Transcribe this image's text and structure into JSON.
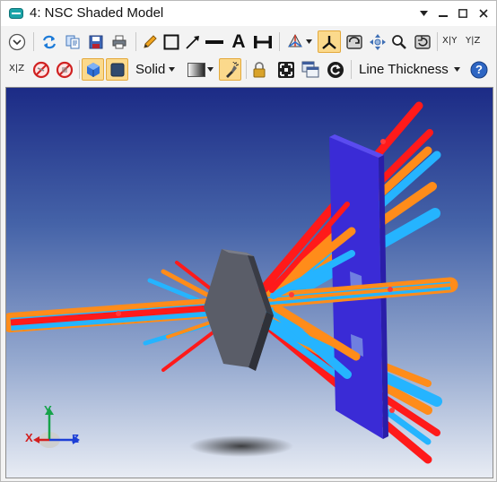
{
  "window": {
    "title": "4: NSC Shaded Model",
    "controls": [
      "pin",
      "minimize",
      "maximize",
      "close"
    ]
  },
  "toolbar_row1": {
    "items": [
      "settings-dropdown",
      "refresh-icon",
      "copy-icon",
      "save-icon",
      "print-icon",
      "pencil-icon",
      "rectangle-icon",
      "arrow-icon",
      "line-icon",
      "text-icon",
      "dimension-icon",
      "rotate-view-icon",
      "axes-icon",
      "fit-icon",
      "pan-icon",
      "zoom-icon",
      "reset-icon"
    ],
    "text_tool_glyph": "A",
    "xy_label": "X|Y",
    "yz_label": "Y|Z"
  },
  "toolbar_row2": {
    "xz_label": "X|Z",
    "render_mode": "Solid",
    "line_thickness_label": "Line Thickness",
    "help_glyph": "?"
  },
  "viewport": {
    "axis_labels": {
      "x": "X",
      "y": "Y",
      "z": "Z"
    },
    "colors": {
      "background_top": "#1c2b86",
      "background_bottom": "#e8ecf4",
      "ray_red": "#ff1a1a",
      "ray_orange": "#ff8c1a",
      "ray_cyan": "#25b4ff",
      "detector": "#3a2bd6",
      "lens": "#4a4d58"
    }
  }
}
